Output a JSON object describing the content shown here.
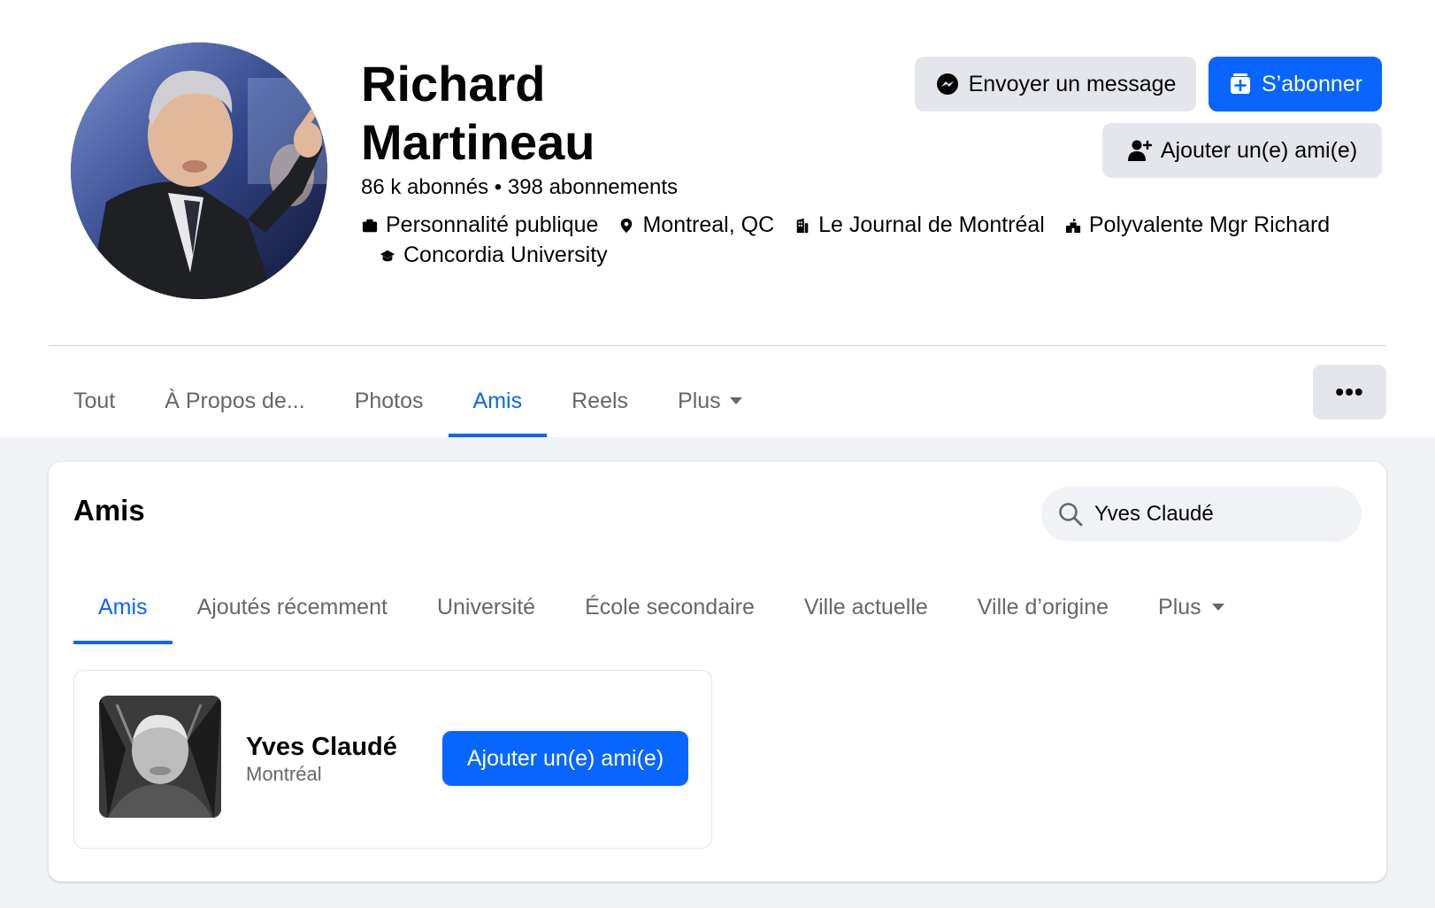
{
  "profile": {
    "name": "Richard Martineau",
    "stats": "86 k abonnés • 398 abonnements",
    "intro_line1": [
      {
        "icon": "briefcase-icon",
        "label": "Personnalité publique"
      },
      {
        "icon": "location-pin-icon",
        "label": "Montreal, QC"
      },
      {
        "icon": "building-icon",
        "label": "Le Journal de Montréal"
      },
      {
        "icon": "school-icon",
        "label": "Polyvalente Mgr Richard"
      }
    ],
    "intro_line2": [
      {
        "icon": "graduation-cap-icon",
        "label": "Concordia University"
      }
    ]
  },
  "actions": {
    "message_label": "Envoyer un message",
    "subscribe_label": "S’abonner",
    "add_friend_label": "Ajouter un(e) ami(e)"
  },
  "tabs": [
    {
      "label": "Tout"
    },
    {
      "label": "À Propos de..."
    },
    {
      "label": "Photos"
    },
    {
      "label": "Amis",
      "active": true
    },
    {
      "label": "Reels"
    },
    {
      "label": "Plus"
    }
  ],
  "more_menu_label": "•••",
  "friends_section": {
    "title": "Amis",
    "search_value": "Yves Claudé",
    "subtabs": [
      {
        "label": "Amis",
        "active": true
      },
      {
        "label": "Ajoutés récemment"
      },
      {
        "label": "Université"
      },
      {
        "label": "École secondaire"
      },
      {
        "label": "Ville actuelle"
      },
      {
        "label": "Ville d’origine"
      },
      {
        "label": "Plus"
      }
    ],
    "results": [
      {
        "name": "Yves Claudé",
        "location": "Montréal",
        "action_label": "Ajouter un(e) ami(e)"
      }
    ]
  },
  "colors": {
    "accent": "#0866ff",
    "button_grey": "#e4e6eb",
    "secondary_text": "#65676b",
    "page_bg": "#f0f2f5"
  }
}
